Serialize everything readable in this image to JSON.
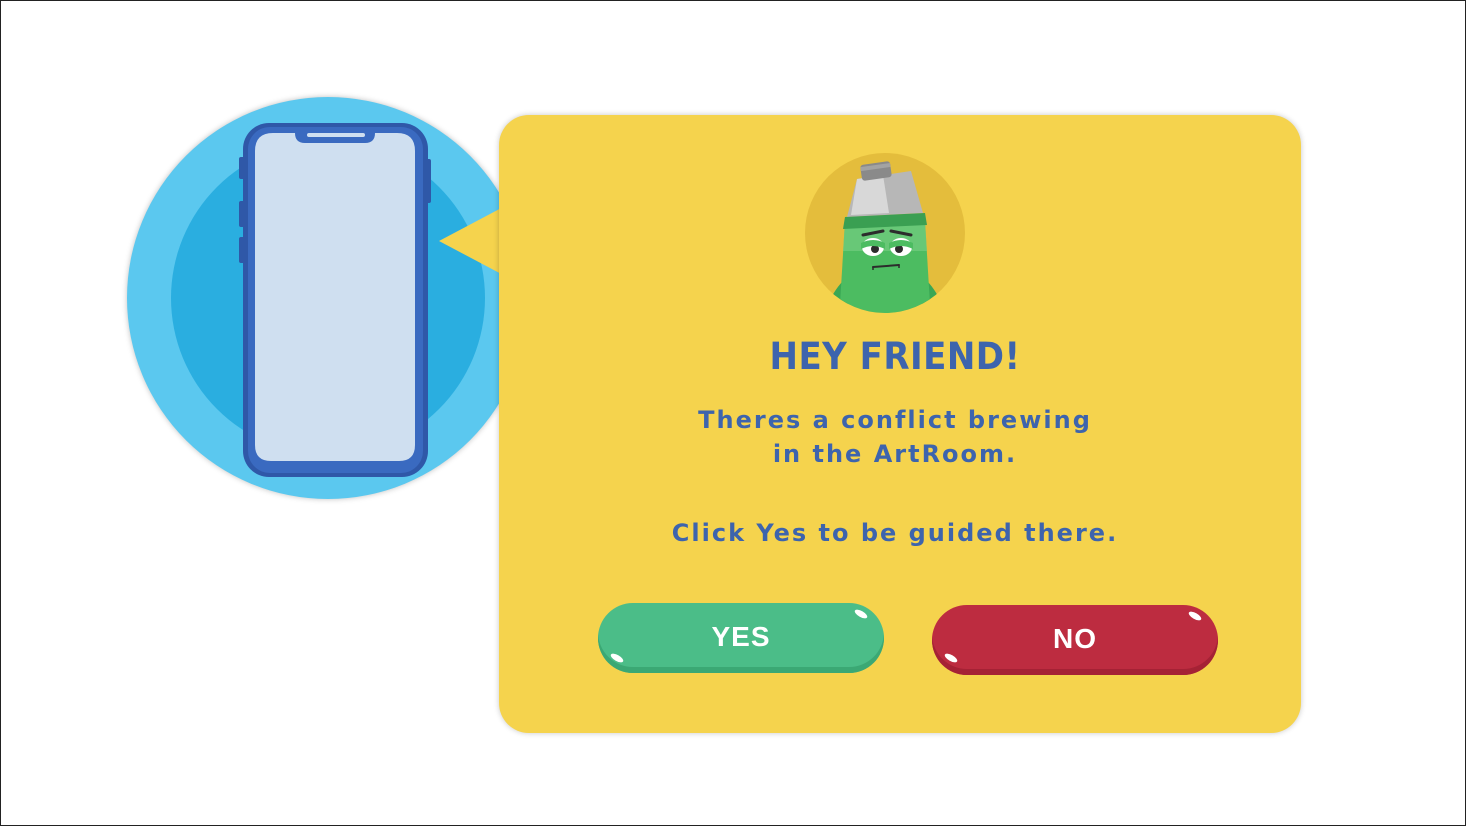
{
  "dialog": {
    "title": "HEY FRIEND!",
    "message_line1": "Theres a conflict brewing",
    "message_line2": "in the ArtRoom.",
    "message_line3": "Click Yes to be guided there.",
    "yes_label": "YES",
    "no_label": "NO"
  },
  "colors": {
    "dialog_bg": "#f5d34d",
    "text_blue": "#3d64ad",
    "yes_green": "#4bbd88",
    "no_red": "#bd2c40",
    "phone_circle_outer": "#5bc8ef",
    "phone_circle_inner": "#2aaee0"
  },
  "icons": {
    "phone": "smartphone-icon",
    "avatar": "paint-tube-character-avatar"
  }
}
